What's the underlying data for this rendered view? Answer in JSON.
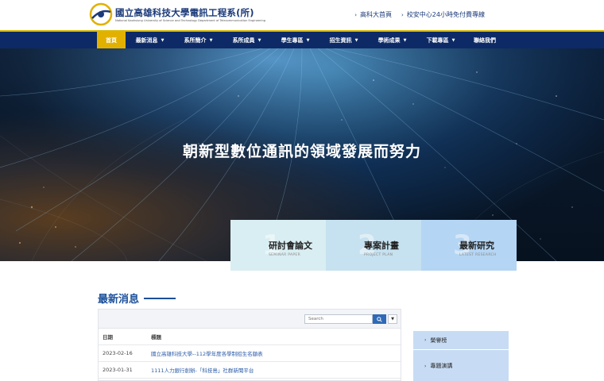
{
  "header": {
    "title": "國立高雄科技大學電訊工程系(所)",
    "subtitle": "National Kaohsiung University of Science and Technology Department of Telecommunication Engineering",
    "links": [
      {
        "label": "高科大首頁"
      },
      {
        "label": "校安中心24小時免付費專線"
      }
    ]
  },
  "nav": {
    "items": [
      {
        "label": "首頁",
        "dropdown": false,
        "active": true
      },
      {
        "label": "最新消息",
        "dropdown": true
      },
      {
        "label": "系所簡介",
        "dropdown": true
      },
      {
        "label": "系所成員",
        "dropdown": true
      },
      {
        "label": "學生專區",
        "dropdown": true
      },
      {
        "label": "招生資訊",
        "dropdown": true
      },
      {
        "label": "學術成果",
        "dropdown": true
      },
      {
        "label": "下載專區",
        "dropdown": true
      },
      {
        "label": "聯絡我們",
        "dropdown": false
      }
    ]
  },
  "hero": {
    "title": "朝新型數位通訊的領域發展而努力"
  },
  "features": [
    {
      "num": "1",
      "title": "研討會論文",
      "sub": "SEMINAR PAPER"
    },
    {
      "num": "2",
      "title": "專案計畫",
      "sub": "PROJECT PLAN"
    },
    {
      "num": "3",
      "title": "最新研究",
      "sub": "LATEST RESEARCH"
    }
  ],
  "news": {
    "heading": "最新消息",
    "search_placeholder": "Search",
    "columns": {
      "date": "日期",
      "title": "標題"
    },
    "rows": [
      {
        "date": "2023-02-16",
        "title": "國立高雄科技大學--112學年度各學制招生名額表"
      },
      {
        "date": "2023-01-31",
        "title": "1111人力銀行創辦-「科技島」社群新聞平台"
      }
    ]
  },
  "sidebar": {
    "items": [
      {
        "label": "榮譽榜"
      },
      {
        "label": "專題演講"
      }
    ]
  },
  "colors": {
    "navy": "#0d2a66",
    "gold": "#e2b100",
    "link": "#2a5aa8",
    "search_button": "#2f6ab7"
  }
}
